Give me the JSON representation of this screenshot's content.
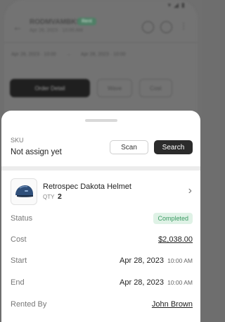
{
  "background": {
    "code": "RODMVAMBKS",
    "status_chip": "Rent",
    "subtitle": "Apr 28, 2023 · 10:00 AM",
    "dates": [
      "Apr 28, 2023 · 10:00",
      "→",
      "Apr 28, 2023 · 10:00"
    ],
    "buttons": [
      "Order Detail",
      "Wave",
      "Cost"
    ]
  },
  "sheet": {
    "sku_label": "SKU",
    "sku_value": "Not assign yet",
    "scan_label": "Scan",
    "search_label": "Search",
    "product": {
      "name": "Retrospec Dakota Helmet",
      "qty_label": "QTY",
      "qty": "2"
    },
    "details": {
      "status_label": "Status",
      "status_value": "Completed",
      "status_color": "#3b9a63",
      "cost_label": "Cost",
      "cost_value": "$2,038.00",
      "start_label": "Start",
      "start_date": "Apr 28, 2023",
      "start_time": "10:00 AM",
      "end_label": "End",
      "end_date": "Apr 28, 2023",
      "end_time": "10:00 AM",
      "rented_by_label": "Rented By",
      "rented_by_value": "John Brown"
    }
  },
  "icons": {
    "back": "arrow-left-icon",
    "chevron": "chevron-right-icon",
    "product": "helmet-icon"
  }
}
